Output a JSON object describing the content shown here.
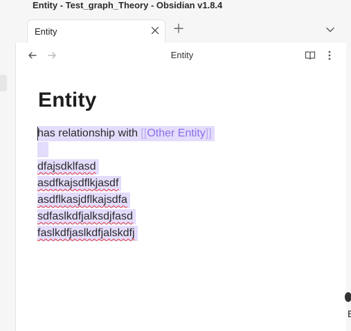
{
  "window": {
    "title": "Entity - Test_graph_Theory - Obsidian v1.8.4"
  },
  "tabs": [
    {
      "label": "Entity",
      "active": true
    }
  ],
  "view": {
    "title": "Entity"
  },
  "note": {
    "title": "Entity",
    "first_line_prefix": "has relationship with ",
    "link": {
      "open": "[[",
      "text": "Other Entity",
      "close": "]]"
    },
    "lines": [
      "dfajsdklfasd",
      "asdfkajsdflkjasdf",
      "asdflkasjdflkajsdfa",
      "sdfaslkdfjalksdjfasd",
      "faslkdfjaslkdfjalskdfj"
    ]
  },
  "right_edge_letter": "E",
  "colors": {
    "selection": "#e4dcfb",
    "link": "#8a6fe8",
    "bracket": "#b9a7f2",
    "spell_underline": "#e23a3a"
  }
}
